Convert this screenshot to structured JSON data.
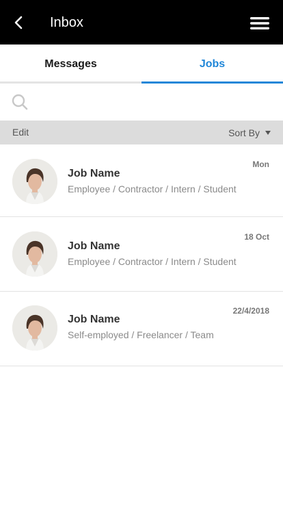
{
  "header": {
    "title": "Inbox",
    "back_icon": "chevron-left-icon",
    "menu_icon": "hamburger-menu-icon",
    "background": "#000000"
  },
  "tabs": [
    {
      "label": "Messages",
      "active": false
    },
    {
      "label": "Jobs",
      "active": true
    }
  ],
  "accent_color": "#1f86d8",
  "search": {
    "placeholder": "",
    "icon": "search-icon"
  },
  "toolbar": {
    "edit_label": "Edit",
    "sort_label": "Sort By"
  },
  "jobs": [
    {
      "title": "Job Name",
      "type": "Employee / Contractor / Intern / Student",
      "date": "Mon"
    },
    {
      "title": "Job Name",
      "type": "Employee / Contractor / Intern / Student",
      "date": "18 Oct"
    },
    {
      "title": "Job Name",
      "type": "Self-employed / Freelancer / Team",
      "date": "22/4/2018"
    }
  ]
}
